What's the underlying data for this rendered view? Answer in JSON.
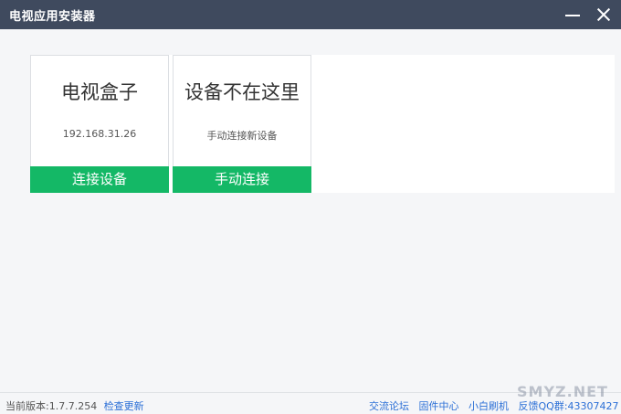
{
  "window": {
    "title": "电视应用安装器"
  },
  "cards": [
    {
      "title": "电视盒子",
      "subtitle": "192.168.31.26",
      "button": "连接设备"
    },
    {
      "title": "设备不在这里",
      "subtitle": "手动连接新设备",
      "button": "手动连接"
    }
  ],
  "statusbar": {
    "version_label": "当前版本:1.7.7.254",
    "check_update": "检查更新",
    "links": [
      "交流论坛",
      "固件中心",
      "小白刷机"
    ],
    "qq": "反馈QQ群:43307427"
  },
  "watermark": "SMYZ.NET",
  "colors": {
    "titlebar": "#3f4a5e",
    "accent_green": "#14b866",
    "link_blue": "#2b6fd6"
  }
}
